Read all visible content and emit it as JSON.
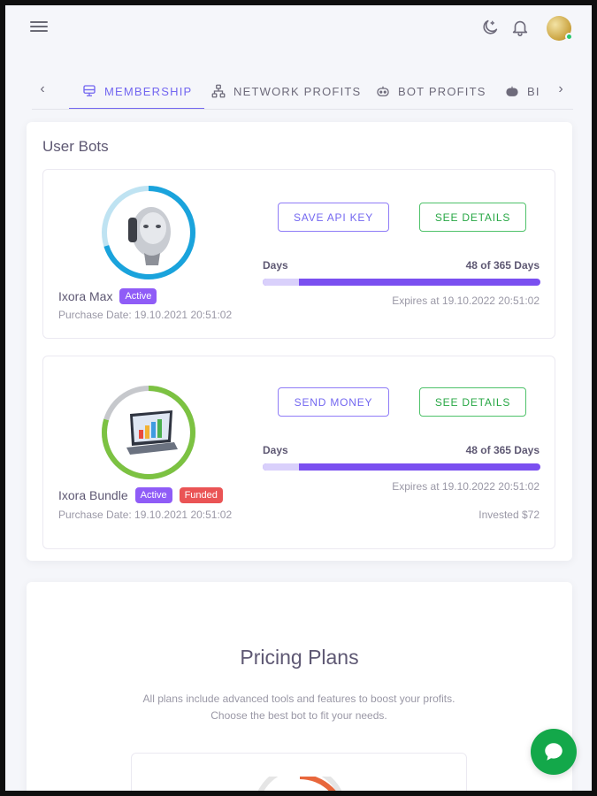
{
  "header": {
    "icons": [
      "menu-icon",
      "moon-icon",
      "bell-icon",
      "avatar"
    ],
    "status_color": "#28c76f"
  },
  "tabs": {
    "items": [
      {
        "label": "MEMBERSHIP",
        "icon": "membership-icon",
        "active": true
      },
      {
        "label": "NETWORK PROFITS",
        "icon": "network-icon",
        "active": false
      },
      {
        "label": "BOT PROFITS",
        "icon": "bot-icon",
        "active": false
      },
      {
        "label": "BI",
        "icon": "bot-icon",
        "active": false
      }
    ],
    "accent": "#7367f0"
  },
  "user_bots": {
    "title": "User Bots",
    "bots": [
      {
        "name": "Ixora Max",
        "badges": [
          "Active"
        ],
        "purchase_date": "Purchase Date: 19.10.2021 20:51:02",
        "primary_button": "SAVE API KEY",
        "details_button": "SEE DETAILS",
        "days_label": "Days",
        "days_value": "48 of 365 Days",
        "elapsed_days": 48,
        "total_days": 365,
        "expires": "Expires at 19.10.2022 20:51:02"
      },
      {
        "name": "Ixora Bundle",
        "badges": [
          "Active",
          "Funded"
        ],
        "purchase_date": "Purchase Date: 19.10.2021 20:51:02",
        "primary_button": "SEND MONEY",
        "details_button": "SEE DETAILS",
        "days_label": "Days",
        "days_value": "48 of 365 Days",
        "elapsed_days": 48,
        "total_days": 365,
        "expires": "Expires at 19.10.2022 20:51:02",
        "invested": "Invested $72"
      }
    ]
  },
  "pricing": {
    "title": "Pricing Plans",
    "subtitle": "All plans include advanced tools and features to boost your profits. Choose the best bot to fit your needs."
  },
  "colors": {
    "active_badge": "#8f5cf7",
    "funded_badge": "#ea5455",
    "progress": "#7a4ff0",
    "green": "#28a745",
    "chat": "#13a84a"
  }
}
